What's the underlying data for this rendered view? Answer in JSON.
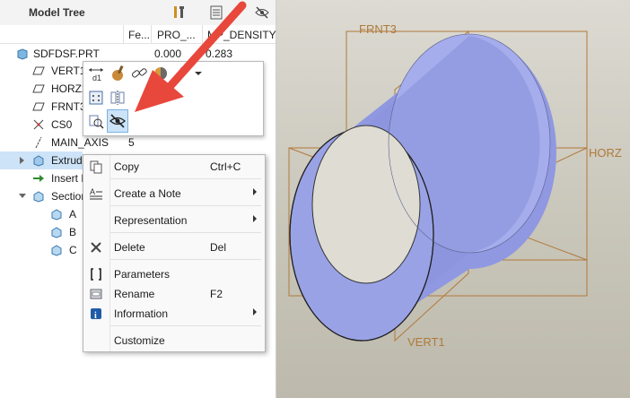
{
  "tree": {
    "title": "Model Tree",
    "columns": [
      "Fe...",
      "PRO_...",
      "MP_DENSITY"
    ],
    "rows": [
      {
        "label": "SDFDSF.PRT",
        "v1": "",
        "v2": "0.000",
        "v3": "0.283"
      },
      {
        "label": "VERT1",
        "v1": "",
        "v2": "",
        "v3": ""
      },
      {
        "label": "HORZ2",
        "v1": "",
        "v2": "",
        "v3": ""
      },
      {
        "label": "FRNT3",
        "v1": "",
        "v2": "",
        "v3": ""
      },
      {
        "label": "CS0",
        "v1": "",
        "v2": "",
        "v3": ""
      },
      {
        "label": "MAIN_AXIS",
        "v1": "5",
        "v2": "",
        "v3": ""
      },
      {
        "label": "Extrude",
        "v1": "",
        "v2": "",
        "v3": ""
      },
      {
        "label": "Insert H",
        "v1": "",
        "v2": "",
        "v3": ""
      },
      {
        "label": "Section",
        "v1": "",
        "v2": "",
        "v3": ""
      },
      {
        "label": "A",
        "v1": "",
        "v2": "",
        "v3": ""
      },
      {
        "label": "B",
        "v1": "",
        "v2": "",
        "v3": ""
      },
      {
        "label": "C",
        "v1": "",
        "v2": "",
        "v3": ""
      }
    ]
  },
  "context_menu": {
    "items": [
      {
        "label": "Copy",
        "shortcut": "Ctrl+C",
        "icon": "copy-icon"
      },
      {
        "label": "Create a Note",
        "shortcut": "",
        "icon": "note-icon"
      },
      {
        "label": "Representation",
        "shortcut": "",
        "icon": ""
      },
      {
        "label": "Delete",
        "shortcut": "Del",
        "icon": "delete-icon"
      },
      {
        "label": "Parameters",
        "shortcut": "",
        "icon": "parameters-icon"
      },
      {
        "label": "Rename",
        "shortcut": "F2",
        "icon": "rename-icon"
      },
      {
        "label": "Information",
        "shortcut": "",
        "icon": "info-icon"
      },
      {
        "label": "Customize",
        "shortcut": "",
        "icon": ""
      }
    ]
  },
  "viewport": {
    "datum_labels": {
      "front": "FRNT3",
      "horz": "HORZ",
      "vert": "VERT1"
    }
  },
  "colors": {
    "cylinder": "#8f98e0",
    "datum": "#b07a3a",
    "arrow": "#e8473c",
    "selection": "#cde3f7"
  }
}
